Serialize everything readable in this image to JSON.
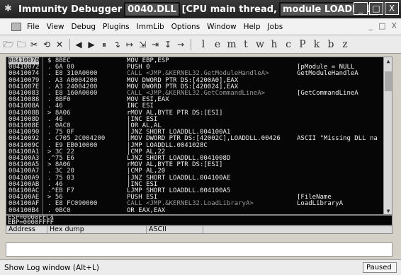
{
  "window": {
    "title_app": "Immunity Debugger",
    "title_file": "0040.DLL",
    "title_cpu": "[CPU  main thread,",
    "title_module": "module LOADDLL]",
    "controls": [
      "_",
      "□",
      "X"
    ]
  },
  "menu": {
    "items": [
      "File",
      "View",
      "Debug",
      "Plugins",
      "ImmLib",
      "Options",
      "Window",
      "Help",
      "Jobs"
    ],
    "mdi_controls": [
      "_",
      "□",
      "X"
    ]
  },
  "toolbar": {
    "icons": [
      "open-file-icon",
      "save-icon",
      "close-file-icon",
      "restart-icon",
      "run-icon",
      "stop-icon",
      "rewind-icon",
      "pause-icon",
      "step-into-icon",
      "step-over-icon",
      "trace-into-icon",
      "trace-over-icon",
      "execute-till-return-icon",
      "goto-icon"
    ],
    "glyphs": [
      "🗁",
      "🗀",
      "✂",
      "⟲",
      "✕",
      "◀",
      "▶",
      "⏸",
      "↴",
      "↦",
      "⇲",
      "⇥",
      "↧",
      "→"
    ],
    "letters": [
      "l",
      "e",
      "m",
      "t",
      "w",
      "h",
      "c",
      "P",
      "k",
      "b",
      "z"
    ]
  },
  "cpu": {
    "rows": [
      {
        "addr": "00410070",
        "hex": "$ 8BEC",
        "asm": "MOV EBP,ESP",
        "cmt": "",
        "selected": true
      },
      {
        "addr": "00410072",
        "hex": ". 6A 00",
        "asm": "PUSH 0",
        "cmt": "[pModule = NULL"
      },
      {
        "addr": "00410074",
        "hex": ". E8 310A0000",
        "asm": "CALL <JMP.&KERNEL32.GetModuleHandleA>",
        "cmt": "GetModuleHandleA",
        "call": true
      },
      {
        "addr": "00410079",
        "hex": ". A3 A0004200",
        "asm": "MOV DWORD PTR DS:[4200A0],EAX",
        "cmt": ""
      },
      {
        "addr": "0041007E",
        "hex": ". A3 24004200",
        "asm": "MOV DWORD PTR DS:[420024],EAX",
        "cmt": ""
      },
      {
        "addr": "00410083",
        "hex": ". E8 160A0000",
        "asm": "CALL <JMP.&KERNEL32.GetCommandLineA>",
        "cmt": "[GetCommandLineA",
        "call": true
      },
      {
        "addr": "00410088",
        "hex": ". 8BF0",
        "asm": "MOV ESI,EAX",
        "cmt": ""
      },
      {
        "addr": "0041008A",
        "hex": ". 46",
        "asm": "INC ESI",
        "cmt": ""
      },
      {
        "addr": "0041008B",
        "hex": "> 8A06",
        "asm": "rMOV AL,BYTE PTR DS:[ESI]",
        "cmt": ""
      },
      {
        "addr": "0041008D",
        "hex": ". 46",
        "asm": "|INC ESI",
        "cmt": ""
      },
      {
        "addr": "0041008E",
        "hex": ". 0AC0",
        "asm": "|OR AL,AL",
        "cmt": ""
      },
      {
        "addr": "00410090",
        "hex": ". 75 0F",
        "asm": "|JNZ SHORT LOADDLL.004100A1",
        "cmt": ""
      },
      {
        "addr": "00410092",
        "hex": ". C705 2C004200",
        "asm": "|MOV DWORD PTR DS:[42002C],LOADDLL.00426",
        "cmt": "ASCII \"Missing DLL na"
      },
      {
        "addr": "0041009C",
        "hex": ". E9 EB010000",
        "asm": "|JMP LOADDLL.0041028C",
        "cmt": ""
      },
      {
        "addr": "004100A1",
        "hex": "> 3C 22",
        "asm": "|CMP AL,22",
        "cmt": ""
      },
      {
        "addr": "004100A3",
        "hex": ".^75 E6",
        "asm": "LJNZ SHORT LOADDLL.0041008D",
        "cmt": ""
      },
      {
        "addr": "004100A5",
        "hex": "> 8A06",
        "asm": "rMOV AL,BYTE PTR DS:[ESI]",
        "cmt": ""
      },
      {
        "addr": "004100A7",
        "hex": ". 3C 20",
        "asm": "|CMP AL,20",
        "cmt": ""
      },
      {
        "addr": "004100A9",
        "hex": ". 75 03",
        "asm": "|JNZ SHORT LOADDLL.004100AE",
        "cmt": ""
      },
      {
        "addr": "004100AB",
        "hex": ". 46",
        "asm": "|INC ESI",
        "cmt": ""
      },
      {
        "addr": "004100AC",
        "hex": ".^EB F7",
        "asm": "LJMP SHORT LOADDLL.004100A5",
        "cmt": ""
      },
      {
        "addr": "004100AE",
        "hex": "> 56",
        "asm": "PUSH ESI",
        "cmt": "[FileName"
      },
      {
        "addr": "004100AF",
        "hex": ". E8 FC090000",
        "asm": "CALL <JMP.&KERNEL32.LoadLibraryA>",
        "cmt": "LoadLibraryA",
        "call": true
      },
      {
        "addr": "004100B4",
        "hex": ". 0BC0",
        "asm": "OR EAX,EAX",
        "cmt": ""
      }
    ],
    "scroll_up": "▲",
    "scroll_down": "▼"
  },
  "registers": {
    "line1": "ESP=0000FFC4",
    "line2": "EBP=0000FFFF"
  },
  "dump": {
    "col_address": "Address",
    "col_hex": "Hex dump",
    "col_ascii": "ASCII"
  },
  "log": {
    "value": ""
  },
  "status": {
    "text": "Show Log window (Alt+L)",
    "state": "Paused"
  }
}
